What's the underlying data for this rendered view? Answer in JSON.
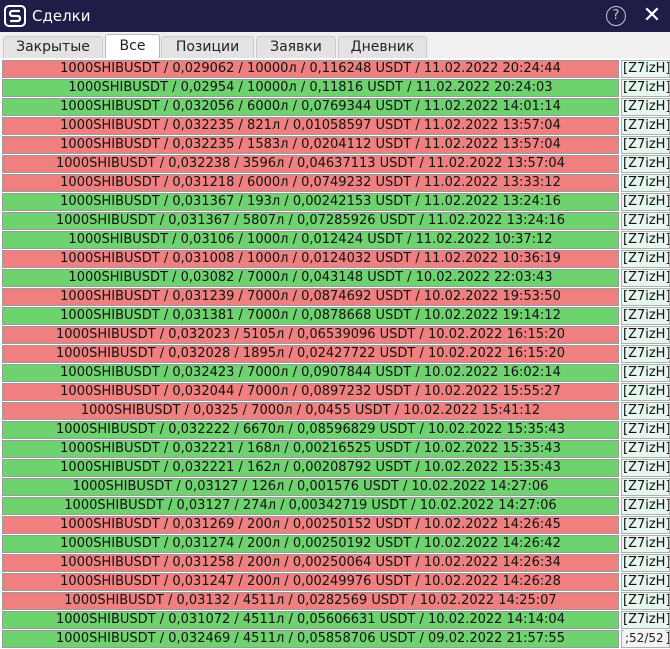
{
  "window": {
    "title": "Сделки",
    "help_icon": "?",
    "close_icon": "✕"
  },
  "tabs": [
    {
      "label": "Закрытые",
      "active": false
    },
    {
      "label": "Все",
      "active": true
    },
    {
      "label": "Позиции",
      "active": false
    },
    {
      "label": "Заявки",
      "active": false
    },
    {
      "label": "Дневник",
      "active": false
    }
  ],
  "colors": {
    "red": "#f08080",
    "green": "#6ed36e"
  },
  "rows": [
    {
      "text": "1000SHIBUSDT / 0,029062 / 10000л / 0,116248 USDT / 11.02.2022 20:24:44",
      "tag": "[Z7izH]",
      "color": "red"
    },
    {
      "text": "1000SHIBUSDT / 0,02954 / 10000л / 0,11816 USDT / 11.02.2022 20:24:03",
      "tag": "[Z7izH]",
      "color": "green"
    },
    {
      "text": "1000SHIBUSDT / 0,032056 / 6000л / 0,0769344 USDT / 11.02.2022 14:01:14",
      "tag": "[Z7izH]",
      "color": "green"
    },
    {
      "text": "1000SHIBUSDT / 0,032235 / 821л / 0,01058597 USDT / 11.02.2022 13:57:04",
      "tag": "[Z7izH]",
      "color": "red"
    },
    {
      "text": "1000SHIBUSDT / 0,032235 / 1583л / 0,0204112 USDT / 11.02.2022 13:57:04",
      "tag": "[Z7izH]",
      "color": "red"
    },
    {
      "text": "1000SHIBUSDT / 0,032238 / 3596л / 0,04637113 USDT / 11.02.2022 13:57:04",
      "tag": "[Z7izH]",
      "color": "red"
    },
    {
      "text": "1000SHIBUSDT / 0,031218 / 6000л / 0,0749232 USDT / 11.02.2022 13:33:12",
      "tag": "[Z7izH]",
      "color": "red"
    },
    {
      "text": "1000SHIBUSDT / 0,031367 / 193л / 0,00242153 USDT / 11.02.2022 13:24:16",
      "tag": "[Z7izH]",
      "color": "green"
    },
    {
      "text": "1000SHIBUSDT / 0,031367 / 5807л / 0,07285926 USDT / 11.02.2022 13:24:16",
      "tag": "[Z7izH]",
      "color": "green"
    },
    {
      "text": "1000SHIBUSDT / 0,03106 / 1000л / 0,012424 USDT / 11.02.2022 10:37:12",
      "tag": "[Z7izH]",
      "color": "green"
    },
    {
      "text": "1000SHIBUSDT / 0,031008 / 1000л / 0,0124032 USDT / 11.02.2022 10:36:19",
      "tag": "[Z7izH]",
      "color": "red"
    },
    {
      "text": "1000SHIBUSDT / 0,03082 / 7000л / 0,043148 USDT / 10.02.2022 22:03:43",
      "tag": "[Z7izH]",
      "color": "green"
    },
    {
      "text": "1000SHIBUSDT / 0,031239 / 7000л / 0,0874692 USDT / 10.02.2022 19:53:50",
      "tag": "[Z7izH]",
      "color": "red"
    },
    {
      "text": "1000SHIBUSDT / 0,031381 / 7000л / 0,0878668 USDT / 10.02.2022 19:14:12",
      "tag": "[Z7izH]",
      "color": "green"
    },
    {
      "text": "1000SHIBUSDT / 0,032023 / 5105л / 0,06539096 USDT / 10.02.2022 16:15:20",
      "tag": "[Z7izH]",
      "color": "red"
    },
    {
      "text": "1000SHIBUSDT / 0,032028 / 1895л / 0,02427722 USDT / 10.02.2022 16:15:20",
      "tag": "[Z7izH]",
      "color": "red"
    },
    {
      "text": "1000SHIBUSDT / 0,032423 / 7000л / 0,0907844 USDT / 10.02.2022 16:02:14",
      "tag": "[Z7izH]",
      "color": "green"
    },
    {
      "text": "1000SHIBUSDT / 0,032044 / 7000л / 0,0897232 USDT / 10.02.2022 15:55:27",
      "tag": "[Z7izH]",
      "color": "red"
    },
    {
      "text": "1000SHIBUSDT / 0,0325 / 7000л / 0,0455 USDT / 10.02.2022 15:41:12",
      "tag": "[Z7izH]",
      "color": "red"
    },
    {
      "text": "1000SHIBUSDT / 0,032222 / 6670л / 0,08596829 USDT / 10.02.2022 15:35:43",
      "tag": "[Z7izH]",
      "color": "green"
    },
    {
      "text": "1000SHIBUSDT / 0,032221 / 168л / 0,00216525 USDT / 10.02.2022 15:35:43",
      "tag": "[Z7izH]",
      "color": "green"
    },
    {
      "text": "1000SHIBUSDT / 0,032221 / 162л / 0,00208792 USDT / 10.02.2022 15:35:43",
      "tag": "[Z7izH]",
      "color": "green"
    },
    {
      "text": "1000SHIBUSDT / 0,03127 / 126л / 0,001576 USDT / 10.02.2022 14:27:06",
      "tag": "[Z7izH]",
      "color": "green"
    },
    {
      "text": "1000SHIBUSDT / 0,03127 / 274л / 0,00342719 USDT / 10.02.2022 14:27:06",
      "tag": "[Z7izH]",
      "color": "green"
    },
    {
      "text": "1000SHIBUSDT / 0,031269 / 200л / 0,00250152 USDT / 10.02.2022 14:26:45",
      "tag": "[Z7izH]",
      "color": "red"
    },
    {
      "text": "1000SHIBUSDT / 0,031274 / 200л / 0,00250192 USDT / 10.02.2022 14:26:42",
      "tag": "[Z7izH]",
      "color": "green"
    },
    {
      "text": "1000SHIBUSDT / 0,031258 / 200л / 0,00250064 USDT / 10.02.2022 14:26:34",
      "tag": "[Z7izH]",
      "color": "red"
    },
    {
      "text": "1000SHIBUSDT / 0,031247 / 200л / 0,00249976 USDT / 10.02.2022 14:26:28",
      "tag": "[Z7izH]",
      "color": "red"
    },
    {
      "text": "1000SHIBUSDT / 0,03132 / 4511л / 0,0282569 USDT / 10.02.2022 14:25:07",
      "tag": "[Z7izH]",
      "color": "red"
    },
    {
      "text": "1000SHIBUSDT / 0,031072 / 4511л / 0,05606631 USDT / 10.02.2022 14:14:04",
      "tag": "[Z7izH]",
      "color": "green"
    },
    {
      "text": "1000SHIBUSDT / 0,032469 / 4511л / 0,05858706 USDT / 09.02.2022 21:57:55",
      "tag": "[Z7izH]",
      "color": "green"
    }
  ],
  "counter": ";52/52"
}
